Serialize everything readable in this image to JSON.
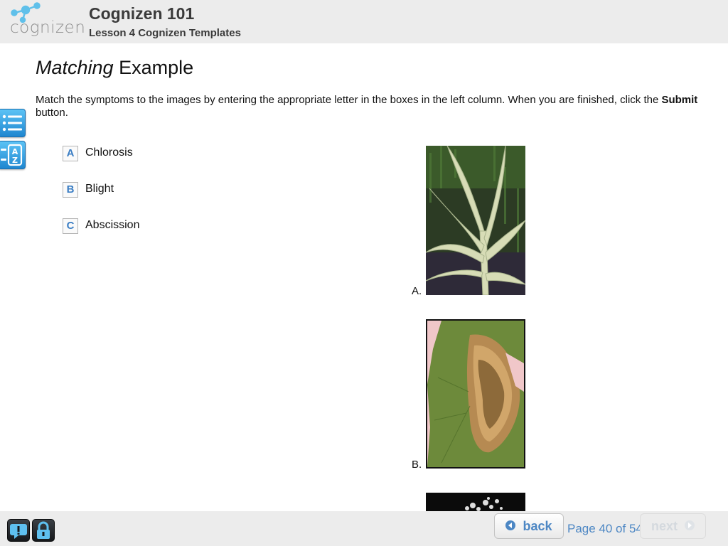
{
  "header": {
    "logo_text": "cognizen",
    "course_title": "Cognizen 101",
    "lesson_title": "Lesson 4 Cognizen Templates"
  },
  "page": {
    "heading_italic": "Matching",
    "heading_rest": " Example",
    "instructions": {
      "before": "Match the symptoms to the images by entering the appropriate letter in the boxes in the left column. When you are finished, click the ",
      "bold": "Submit",
      "after": " button."
    }
  },
  "sidebar": {
    "toc_icon": "list-icon",
    "glossary_icon": "a-z-glossary-icon"
  },
  "matches": [
    {
      "letter": "A",
      "label": "Chlorosis"
    },
    {
      "letter": "B",
      "label": "Blight"
    },
    {
      "letter": "C",
      "label": "Abscission"
    }
  ],
  "images": [
    {
      "letter": "A."
    },
    {
      "letter": "B."
    }
  ],
  "footer": {
    "help_icon": "help-bubble-icon",
    "lock_icon": "padlock-icon",
    "back_label": "back",
    "next_label": "next",
    "page_indicator": "Page 40 of 54"
  },
  "colors": {
    "accent": "#4d87c4",
    "header_bg": "#ececec",
    "sidebar_button": "#1f86d0"
  }
}
